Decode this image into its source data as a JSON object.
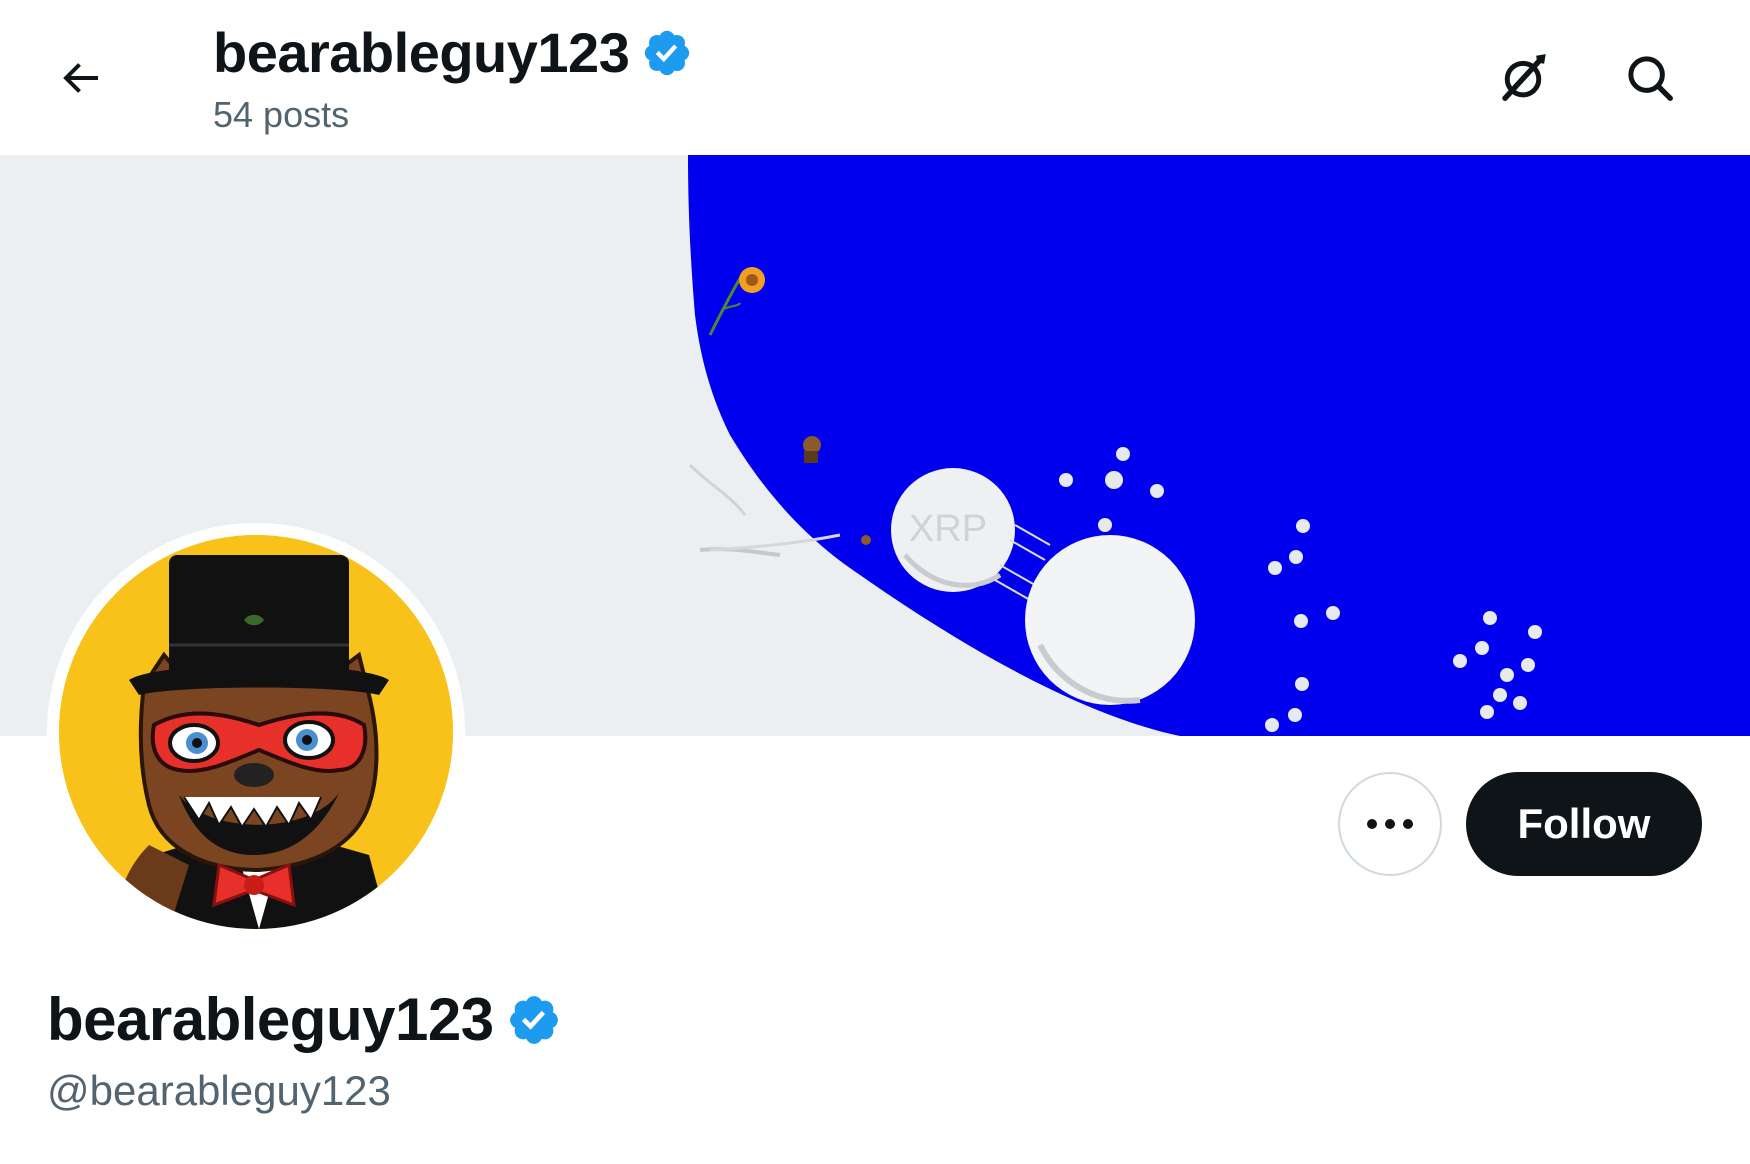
{
  "header": {
    "display_name": "bearableguy123",
    "posts_count": "54 posts",
    "back_icon": "arrow-left-icon",
    "grok_icon": "grok-icon",
    "search_icon": "search-icon"
  },
  "banner": {
    "watermark_text": "XRP",
    "colors": {
      "sky": "#0000ee",
      "snow": "#eceff1"
    }
  },
  "profile": {
    "display_name": "bearableguy123",
    "handle": "@bearableguy123",
    "verified_icon": "verified-badge-icon",
    "avatar_background": "#f9c21a"
  },
  "actions": {
    "more_icon": "more-dots-icon",
    "follow_label": "Follow"
  },
  "colors": {
    "verified_blue": "#1d9bf0",
    "text_primary": "#0f1419",
    "text_secondary": "#536471"
  }
}
